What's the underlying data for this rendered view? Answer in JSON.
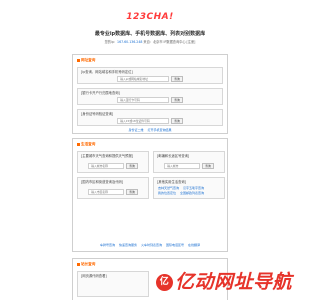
{
  "header": {
    "logo_text": "123CHA!",
    "subtitle": "最专业ip数据库、手机号数据库、列表对别数据库",
    "ip_prefix": "您的ip：",
    "ip_value": "167.60.136.248",
    "ip_suffix": "来自：北京市 IP数据查询中心 [注册]"
  },
  "section1": {
    "title": "网址查询",
    "queries": [
      {
        "label": "[ip查询、网站域名和手机号码定位]",
        "placeholder": "输入ip或网站域名地址",
        "button": "查询"
      },
      {
        "label": "[银行卡开户行归属地查询]",
        "placeholder": "输入银行卡号码",
        "button": "查询"
      },
      {
        "label": "[身份证号码验证查询]",
        "placeholder": "输入15或18位证件号码",
        "button": "查询"
      }
    ],
    "links": [
      "身份证二维",
      "打开手机查询结果"
    ]
  },
  "section2": {
    "title": "生活查询",
    "queries": [
      {
        "label": "[主要城市天气查询和提供天气预报]",
        "placeholder": "输入城市名称",
        "button": "查询"
      },
      {
        "label": "[邮编和长途区号查询]",
        "placeholder": "输入城市",
        "button": "查询"
      },
      {
        "label": "[国内市区和街道查询及代码]",
        "placeholder": "输入市区名称",
        "button": "查询"
      },
      {
        "label": "[其他实用生活查询]",
        "placeholder": "",
        "button": ""
      }
    ],
    "side_links": [
      "吉林天然气查询",
      "汉字五笔字查询",
      "我的位置定位",
      "全国邮政列表查询"
    ],
    "links": [
      "车牌号查询",
      "快递查询服务",
      "火车时刻表查询",
      "国际电话区号",
      "在线翻译"
    ]
  },
  "section3": {
    "title": "站长查询",
    "queries": [
      {
        "label": "[网页源代码查看]",
        "placeholder": "",
        "button": ""
      }
    ]
  },
  "footer": {
    "brand": "亿动网址导航",
    "glyph": "亿"
  }
}
